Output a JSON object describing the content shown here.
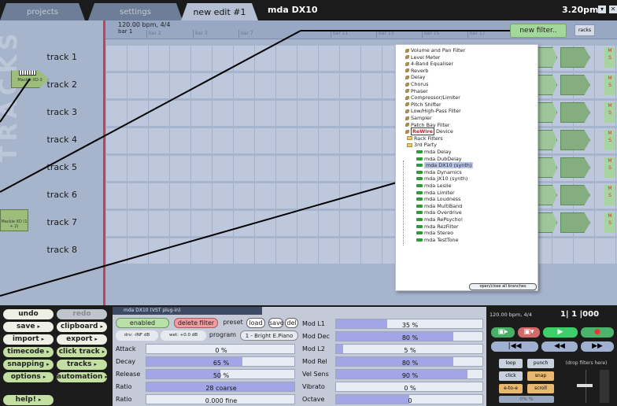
{
  "top": {
    "tabs": [
      "projects",
      "settings",
      "new edit #1"
    ],
    "window_title": "mda DX10",
    "clock": "3.20pm"
  },
  "ruler": {
    "tempo": "120.00 bpm, 4/4",
    "bar_label": "bar 1",
    "ticks": [
      "bar 2",
      "bar 3",
      "bar 5",
      "bar 7",
      "bar 9",
      "bar 11",
      "bar 13",
      "bar 15",
      "bar 17"
    ]
  },
  "toolbar": {
    "new_filter": "new filter..",
    "racks": "racks"
  },
  "tracks": [
    "track 1",
    "track 2",
    "track 3",
    "track 4",
    "track 5",
    "track 6",
    "track 7",
    "track 8"
  ],
  "devices": {
    "device1": "Mackie XD-3",
    "device2": "Mackie XD (1 + 2)"
  },
  "side_text": "TRACKS",
  "filter_menu": {
    "items": [
      {
        "label": "Volume and Pan Filter",
        "icon": "wrench-icon"
      },
      {
        "label": "Level Meter",
        "icon": "wrench-icon"
      },
      {
        "label": "4-Band Equaliser",
        "icon": "wrench-icon"
      },
      {
        "label": "Reverb",
        "icon": "wrench-icon"
      },
      {
        "label": "Delay",
        "icon": "wrench-icon"
      },
      {
        "label": "Chorus",
        "icon": "wrench-icon"
      },
      {
        "label": "Phaser",
        "icon": "wrench-icon"
      },
      {
        "label": "Compressor/Limiter",
        "icon": "wrench-icon"
      },
      {
        "label": "Pitch Shifter",
        "icon": "wrench-icon"
      },
      {
        "label": "Low/High-Pass Filter",
        "icon": "wrench-icon"
      },
      {
        "label": "Sampler",
        "icon": "wrench-icon"
      },
      {
        "label": "Patch Bay Filter",
        "icon": "wrench-icon"
      },
      {
        "label": "Device",
        "icon": "rewire-icon",
        "prefix": "ReWire"
      },
      {
        "label": "Rack Filters",
        "icon": "folder-icon"
      },
      {
        "label": "3rd Party",
        "icon": "folder-icon"
      },
      {
        "label": "mda Delay",
        "icon": "plugin-icon"
      },
      {
        "label": "mda DubDelay",
        "icon": "plugin-icon"
      },
      {
        "label": "mda DX10 (synth)",
        "icon": "plugin-icon"
      },
      {
        "label": "mda Dynamics",
        "icon": "plugin-icon"
      },
      {
        "label": "mda JX10 (synth)",
        "icon": "plugin-icon"
      },
      {
        "label": "mda Leslie",
        "icon": "plugin-icon"
      },
      {
        "label": "mda Limiter",
        "icon": "plugin-icon"
      },
      {
        "label": "mda Loudness",
        "icon": "plugin-icon"
      },
      {
        "label": "mda MultiBand",
        "icon": "plugin-icon"
      },
      {
        "label": "mda Overdrive",
        "icon": "plugin-icon"
      },
      {
        "label": "mda RePsycho!",
        "icon": "plugin-icon"
      },
      {
        "label": "mda RezFilter",
        "icon": "plugin-icon"
      },
      {
        "label": "mda Stereo",
        "icon": "plugin-icon"
      },
      {
        "label": "mda TestTone",
        "icon": "plugin-icon"
      }
    ],
    "selected": "mda DX10 (synth)",
    "toggle_all": "open/close all branches"
  },
  "left_buttons": {
    "undo": "undo",
    "redo": "redo",
    "save": "save",
    "clipboard": "clipboard",
    "import": "import",
    "export": "export",
    "timecode": "timecode",
    "click_track": "click track",
    "snapping": "snapping",
    "tracks": "tracks",
    "options": "options",
    "automation": "automation",
    "help": "help!"
  },
  "plugin": {
    "title": "mda DX10 (VST plug-in)",
    "enabled": "enabled",
    "delete": "delete filter",
    "preset": "preset",
    "load": "load",
    "save": "save",
    "del": "del",
    "drv": "drv: -INF dB",
    "wet": "wet: +0.0 dB",
    "program": "program",
    "program_value": "1 - Bright E.Piano",
    "params_left": [
      {
        "name": "Attack",
        "value": "0 %",
        "level": 0.0
      },
      {
        "name": "Decay",
        "value": "65 %",
        "level": 0.65
      },
      {
        "name": "Release",
        "value": "50 %",
        "level": 0.5
      },
      {
        "name": "Ratio",
        "value": "28 coarse",
        "level": 1.0
      },
      {
        "name": "Ratio",
        "value": "0.000 fine",
        "level": 0.0
      }
    ],
    "params_right": [
      {
        "name": "Mod L1",
        "value": "35 %",
        "level": 0.35
      },
      {
        "name": "Mod Dec",
        "value": "80 %",
        "level": 0.8
      },
      {
        "name": "Mod L2",
        "value": "5 %",
        "level": 0.05
      },
      {
        "name": "Mod Rel",
        "value": "80 %",
        "level": 0.8
      },
      {
        "name": "Vel Sens",
        "value": "90 %",
        "level": 0.9
      },
      {
        "name": "Vibrato",
        "value": "0 %",
        "level": 0.0
      },
      {
        "name": "Octave",
        "value": "0",
        "level": 0.5
      }
    ]
  },
  "transport": {
    "tempo": "120.00 bpm, 4/4",
    "position": "1| 1 |000",
    "loop": "loop",
    "punch": "punch",
    "click": "click",
    "snap": "snap",
    "auto_extend": "e-to-e",
    "scroll": "scroll",
    "drop_filters": "(drop filters here)",
    "cpu": "0% %"
  }
}
